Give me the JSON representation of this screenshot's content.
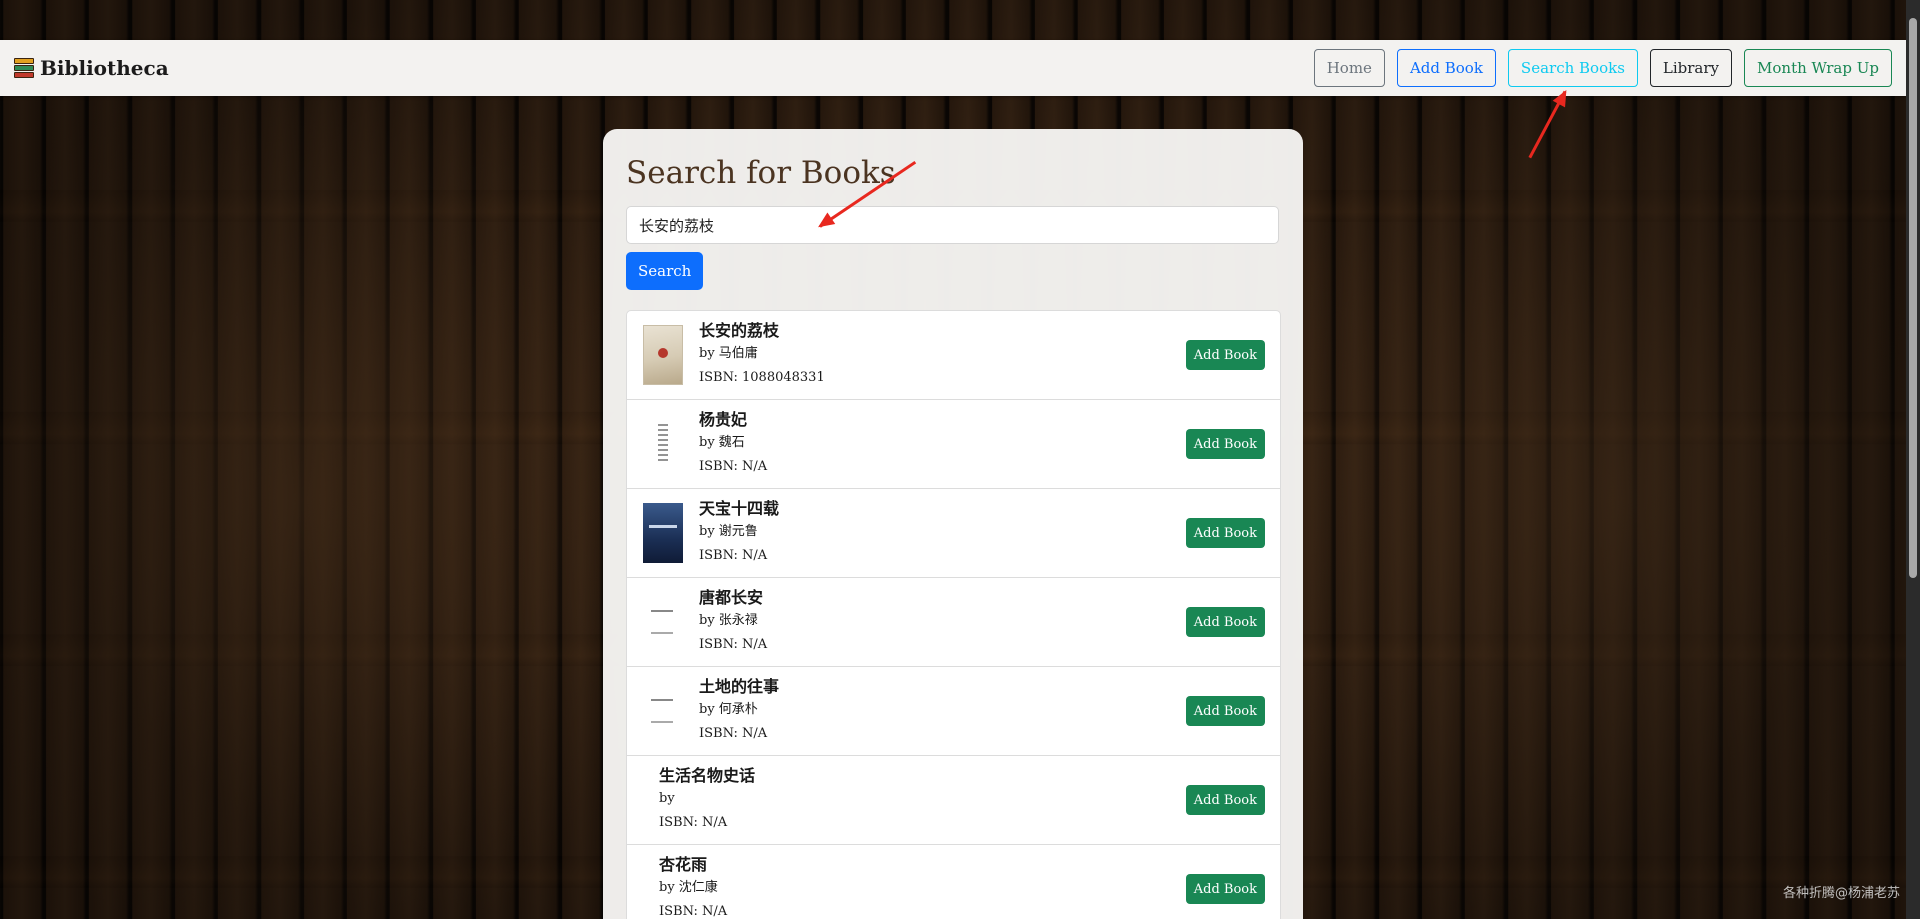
{
  "brand": {
    "name": "Bibliotheca",
    "icon": "stacked-books-icon"
  },
  "nav": {
    "items": [
      {
        "label": "Home",
        "color": "#6c757d",
        "bg": "transparent"
      },
      {
        "label": "Add Book",
        "color": "#0d6efd",
        "bg": "transparent"
      },
      {
        "label": "Search Books",
        "color": "#0dcaf0",
        "bg": "transparent"
      },
      {
        "label": "Library",
        "color": "#212529",
        "bg": "transparent"
      },
      {
        "label": "Month Wrap Up",
        "color": "#198754",
        "bg": "transparent"
      }
    ]
  },
  "search": {
    "title": "Search for Books",
    "value": "长安的荔枝",
    "button_label": "Search"
  },
  "results": [
    {
      "title": "长安的荔枝",
      "author": "by 马伯庸",
      "isbn": "ISBN: 1088048331",
      "cover": "cover-1",
      "add_label": "Add Book"
    },
    {
      "title": "杨贵妃",
      "author": "by 魏石",
      "isbn": "ISBN: N/A",
      "cover": "cover-2",
      "add_label": "Add Book"
    },
    {
      "title": "天宝十四载",
      "author": "by 谢元鲁",
      "isbn": "ISBN: N/A",
      "cover": "cover-3",
      "add_label": "Add Book"
    },
    {
      "title": "唐都长安",
      "author": "by 张永禄",
      "isbn": "ISBN: N/A",
      "cover": "cover-4",
      "add_label": "Add Book"
    },
    {
      "title": "土地的往事",
      "author": "by 何承朴",
      "isbn": "ISBN: N/A",
      "cover": "cover-5",
      "add_label": "Add Book"
    },
    {
      "title": "生活名物史话",
      "author": "by",
      "isbn": "ISBN: N/A",
      "cover": "none",
      "add_label": "Add Book"
    },
    {
      "title": "杏花雨",
      "author": "by 沈仁康",
      "isbn": "ISBN: N/A",
      "cover": "none",
      "add_label": "Add Book"
    }
  ],
  "watermark": "各种折腾@杨浦老苏",
  "colors": {
    "accent_blue": "#0d6efd",
    "accent_green": "#198754",
    "annotation_red": "#e8281f"
  }
}
